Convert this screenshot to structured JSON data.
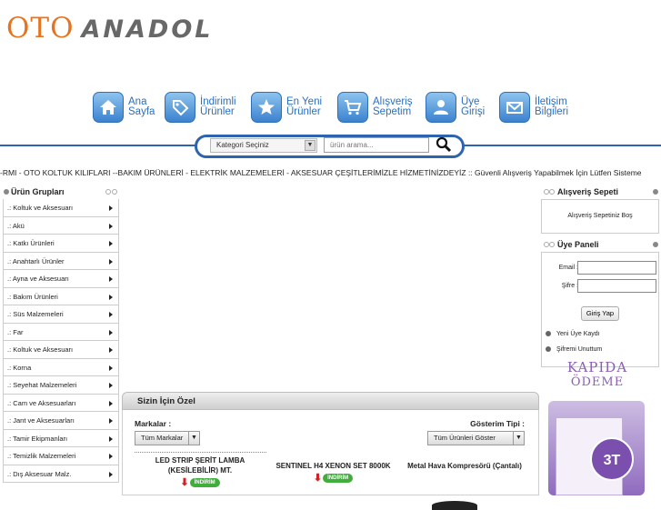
{
  "logo": {
    "part1": "OTO",
    "part2": "ANADOL"
  },
  "nav": [
    {
      "icon": "home-icon",
      "label": "Ana Sayfa"
    },
    {
      "icon": "tag-icon",
      "label": "İndirimli Ürünler"
    },
    {
      "icon": "star-icon",
      "label": "En Yeni Ürünler"
    },
    {
      "icon": "cart-icon",
      "label": "Alışveriş Sepetim"
    },
    {
      "icon": "user-icon",
      "label": "Üye Girişi"
    },
    {
      "icon": "mail-icon",
      "label": "İletişim Bilgileri"
    }
  ],
  "search": {
    "category_value": "Kategori Seçiniz",
    "placeholder": "ürün arama...",
    "button_icon": "search-icon"
  },
  "marquee": "-RMI - OTO KOLTUK KILIFLARI --BAKIM ÜRÜNLERİ - ELEKTRİK MALZEMELERİ - AKSESUAR ÇEŞİTLERİMİZLE HİZMETİNİZDEYİZ :: Güvenli Alışveriş Yapabilmek İçin Lütfen Sisteme",
  "left": {
    "title": "Ürün Grupları",
    "categories": [
      ".: Koltuk ve Aksesuarı",
      ".: Akü",
      ".: Katkı Ürünleri",
      ".: Anahtarlı Ürünler",
      ".: Ayna ve Aksesuarı",
      ".: Bakım Ürünleri",
      ".: Süs Malzemeleri",
      ".: Far",
      ".: Koltuk ve Aksesuarı",
      ".: Korna",
      ".: Seyehat Malzemeleri",
      ".: Cam ve Aksesuarları",
      ".: Jant ve Aksesuarları",
      ".: Tamir Ekipmanları",
      ".: Temizlik Malzemeleri",
      ".: Dış Aksesuar Malz."
    ]
  },
  "center": {
    "title": "Sizin İçin Özel",
    "brands_label": "Markalar :",
    "brands_value": "Tüm Markalar",
    "view_label": "Gösterim Tipi :",
    "view_value": "Tüm Ürünleri Göster",
    "products": [
      {
        "name": "LED STRIP ŞERİT LAMBA (KESİLEBİLİR) MT.",
        "badge": "İNDİRİM"
      },
      {
        "name": "SENTINEL H4 XENON SET 8000K",
        "badge": "İNDİRİM"
      },
      {
        "name": "Metal Hava Kompresörü (Çantalı)"
      }
    ]
  },
  "right": {
    "cart_title": "Alışveriş Sepeti",
    "cart_empty": "Alışveriş Sepetiniz Boş",
    "member_title": "Üye Paneli",
    "email_label": "Email :",
    "password_label": "Şifre :",
    "login_button": "Giriş Yap",
    "register_link": "Yeni Üye Kaydı",
    "forgot_link": "Şifremi Unuttum"
  },
  "banner": {
    "line1": "KAPIDA",
    "line2": "ÖDEME",
    "stamp": "3T"
  },
  "colors": {
    "brand_orange": "#e8731e",
    "nav_blue": "#2a6fc0",
    "search_blue": "#2e63ad",
    "promo_purple": "#8a5fb6",
    "discount_green": "#3fae3a"
  }
}
